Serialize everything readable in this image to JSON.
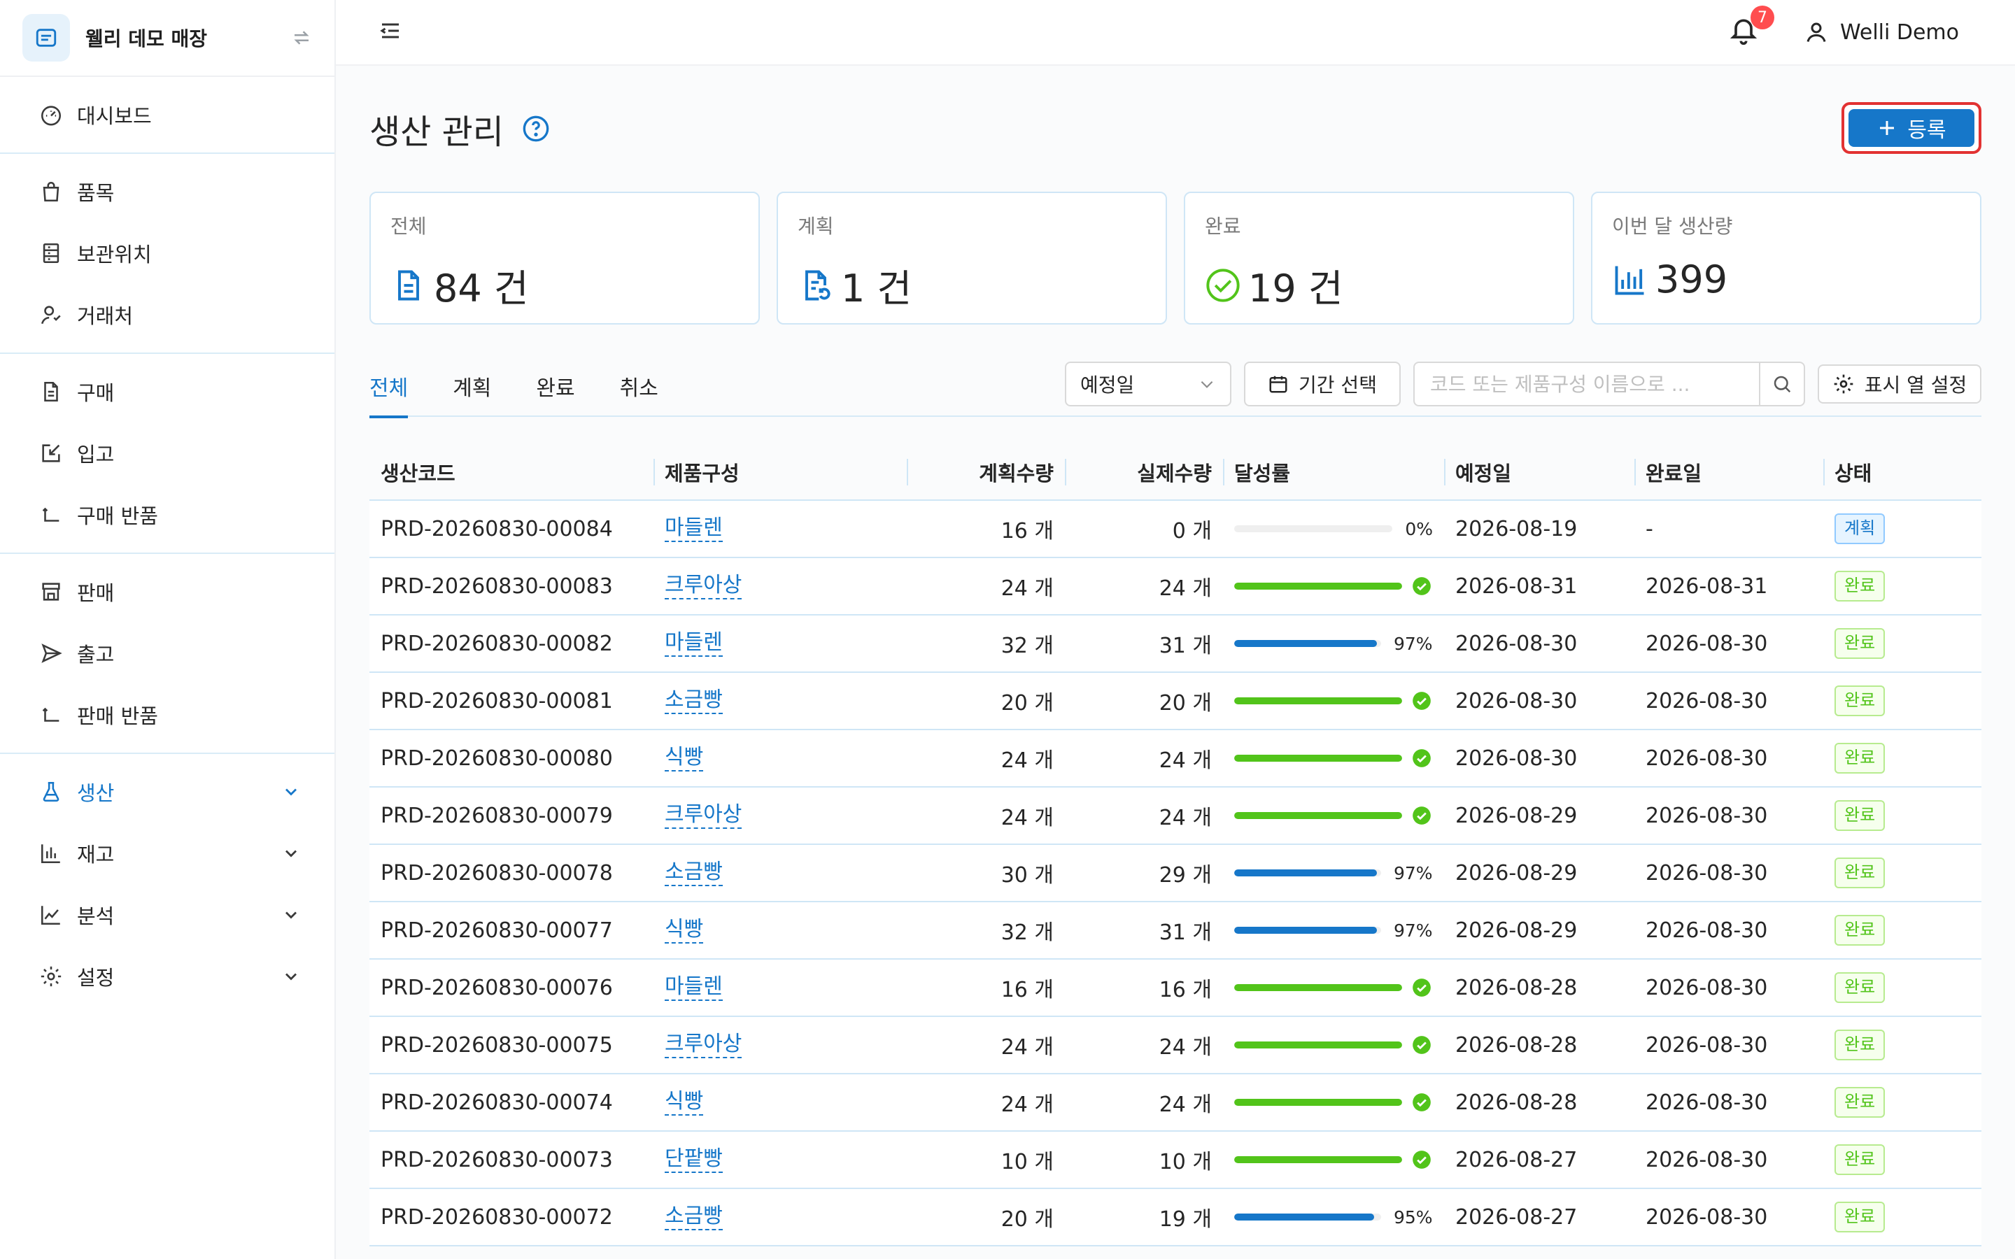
{
  "sidebar": {
    "store_name": "웰리 데모 매장",
    "groups": [
      [
        {
          "label": "대시보드",
          "icon": "dashboard-icon"
        }
      ],
      [
        {
          "label": "품목",
          "icon": "shopping-bag-icon"
        },
        {
          "label": "보관위치",
          "icon": "storage-icon"
        },
        {
          "label": "거래처",
          "icon": "contacts-icon"
        }
      ],
      [
        {
          "label": "구매",
          "icon": "document-icon"
        },
        {
          "label": "입고",
          "icon": "inbound-icon"
        },
        {
          "label": "구매 반품",
          "icon": "return-icon"
        }
      ],
      [
        {
          "label": "판매",
          "icon": "shop-icon"
        },
        {
          "label": "출고",
          "icon": "send-icon"
        },
        {
          "label": "판매 반품",
          "icon": "return-icon"
        }
      ],
      [
        {
          "label": "생산",
          "icon": "flask-icon",
          "active": true,
          "expandable": true
        },
        {
          "label": "재고",
          "icon": "bar-chart-icon",
          "expandable": true
        },
        {
          "label": "분석",
          "icon": "line-chart-icon",
          "expandable": true
        },
        {
          "label": "설정",
          "icon": "gear-icon",
          "expandable": true
        }
      ]
    ]
  },
  "header": {
    "notification_count": "7",
    "user_name": "Welli Demo"
  },
  "page": {
    "title": "생산 관리",
    "register_label": "등록"
  },
  "stats": [
    {
      "label": "전체",
      "value": "84 건",
      "icon": "file-icon",
      "color": "#1677c9"
    },
    {
      "label": "계획",
      "value": "1 건",
      "icon": "file-sync-icon",
      "color": "#1677c9"
    },
    {
      "label": "완료",
      "value": "19 건",
      "icon": "check-circle-icon",
      "color": "#52c41a"
    },
    {
      "label": "이번 달 생산량",
      "value": "399",
      "icon": "bar-chart-icon",
      "color": "#1677c9"
    }
  ],
  "tabs": [
    "전체",
    "계획",
    "완료",
    "취소"
  ],
  "filters": {
    "date_select": "예정일",
    "date_range_label": "기간 선택",
    "search_placeholder": "코드 또는 제품구성 이름으로 ...",
    "columns_label": "표시 열 설정"
  },
  "table": {
    "headers": [
      "생산코드",
      "제품구성",
      "계획수량",
      "실제수량",
      "달성률",
      "예정일",
      "완료일",
      "상태"
    ],
    "rows": [
      {
        "code": "PRD-20260830-00084",
        "product": "마들렌",
        "plan": "16 개",
        "actual": "0 개",
        "rate": 0,
        "rate_label": "0%",
        "due": "2026-08-19",
        "done": "-",
        "status": "계획"
      },
      {
        "code": "PRD-20260830-00083",
        "product": "크루아상",
        "plan": "24 개",
        "actual": "24 개",
        "rate": 100,
        "rate_label": "",
        "due": "2026-08-31",
        "done": "2026-08-31",
        "status": "완료"
      },
      {
        "code": "PRD-20260830-00082",
        "product": "마들렌",
        "plan": "32 개",
        "actual": "31 개",
        "rate": 97,
        "rate_label": "97%",
        "due": "2026-08-30",
        "done": "2026-08-30",
        "status": "완료"
      },
      {
        "code": "PRD-20260830-00081",
        "product": "소금빵",
        "plan": "20 개",
        "actual": "20 개",
        "rate": 100,
        "rate_label": "",
        "due": "2026-08-30",
        "done": "2026-08-30",
        "status": "완료"
      },
      {
        "code": "PRD-20260830-00080",
        "product": "식빵",
        "plan": "24 개",
        "actual": "24 개",
        "rate": 100,
        "rate_label": "",
        "due": "2026-08-30",
        "done": "2026-08-30",
        "status": "완료"
      },
      {
        "code": "PRD-20260830-00079",
        "product": "크루아상",
        "plan": "24 개",
        "actual": "24 개",
        "rate": 100,
        "rate_label": "",
        "due": "2026-08-29",
        "done": "2026-08-30",
        "status": "완료"
      },
      {
        "code": "PRD-20260830-00078",
        "product": "소금빵",
        "plan": "30 개",
        "actual": "29 개",
        "rate": 97,
        "rate_label": "97%",
        "due": "2026-08-29",
        "done": "2026-08-30",
        "status": "완료"
      },
      {
        "code": "PRD-20260830-00077",
        "product": "식빵",
        "plan": "32 개",
        "actual": "31 개",
        "rate": 97,
        "rate_label": "97%",
        "due": "2026-08-29",
        "done": "2026-08-30",
        "status": "완료"
      },
      {
        "code": "PRD-20260830-00076",
        "product": "마들렌",
        "plan": "16 개",
        "actual": "16 개",
        "rate": 100,
        "rate_label": "",
        "due": "2026-08-28",
        "done": "2026-08-30",
        "status": "완료"
      },
      {
        "code": "PRD-20260830-00075",
        "product": "크루아상",
        "plan": "24 개",
        "actual": "24 개",
        "rate": 100,
        "rate_label": "",
        "due": "2026-08-28",
        "done": "2026-08-30",
        "status": "완료"
      },
      {
        "code": "PRD-20260830-00074",
        "product": "식빵",
        "plan": "24 개",
        "actual": "24 개",
        "rate": 100,
        "rate_label": "",
        "due": "2026-08-28",
        "done": "2026-08-30",
        "status": "완료"
      },
      {
        "code": "PRD-20260830-00073",
        "product": "단팥빵",
        "plan": "10 개",
        "actual": "10 개",
        "rate": 100,
        "rate_label": "",
        "due": "2026-08-27",
        "done": "2026-08-30",
        "status": "완료"
      },
      {
        "code": "PRD-20260830-00072",
        "product": "소금빵",
        "plan": "20 개",
        "actual": "19 개",
        "rate": 95,
        "rate_label": "95%",
        "due": "2026-08-27",
        "done": "2026-08-30",
        "status": "완료"
      }
    ]
  },
  "colors": {
    "accent": "#1677c9",
    "success": "#52c41a",
    "highlight_border": "#e23232",
    "badge": "#ff4d4f"
  }
}
